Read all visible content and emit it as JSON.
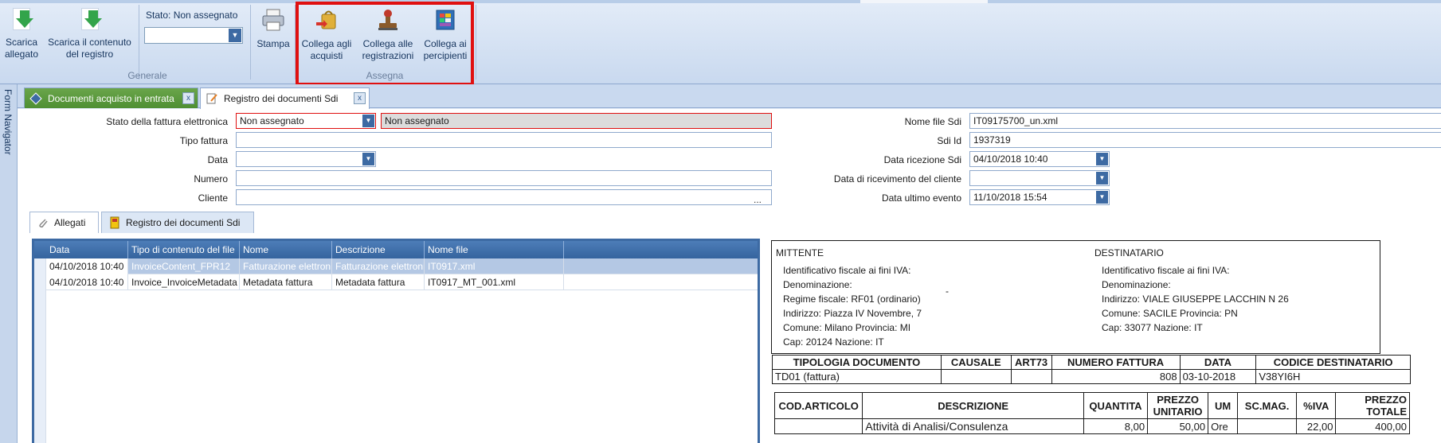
{
  "ribbon": {
    "groups": {
      "generale": "Generale",
      "assegna": "Assegna"
    },
    "buttons": {
      "scarica_allegato": "Scarica\nallegato",
      "scarica_contenuto": "Scarica il contenuto\ndel registro",
      "stampa": "Stampa",
      "collega_acquisti": "Collega agli\nacquisti",
      "collega_registrazioni": "Collega alle\nregistrazioni",
      "collega_percipienti": "Collega ai\npercipienti"
    },
    "stato_label": "Stato: Non assegnato",
    "stato_value": ""
  },
  "form_navigator": "Form Navigator",
  "doc_tabs": [
    {
      "label": "Documenti acquisto in entrata"
    },
    {
      "label": "Registro dei documenti Sdi"
    }
  ],
  "form": {
    "labels": {
      "stato": "Stato della fattura elettronica",
      "tipo": "Tipo fattura",
      "data": "Data",
      "numero": "Numero",
      "cliente": "Cliente",
      "nome_file": "Nome file Sdi",
      "sdi_id": "Sdi Id",
      "data_ricezione": "Data ricezione Sdi",
      "data_ricevimento_cliente": "Data di ricevimento del cliente",
      "data_ultimo_evento": "Data ultimo evento"
    },
    "values": {
      "stato_combo": "Non assegnato",
      "stato_text": "Non assegnato",
      "tipo": "",
      "data": "",
      "numero": "",
      "cliente": "",
      "nome_file": "IT09175700_un.xml",
      "sdi_id": "1937319",
      "data_ricezione": "04/10/2018 10:40",
      "data_ricevimento_cliente": "",
      "data_ultimo_evento": "11/10/2018 15:54"
    },
    "ellipsis": "..."
  },
  "inner_tabs": [
    {
      "label": "Allegati"
    },
    {
      "label": "Registro dei documenti Sdi"
    }
  ],
  "grid": {
    "columns": [
      "Data",
      "Tipo di contenuto del file",
      "Nome",
      "Descrizione",
      "Nome file"
    ],
    "rows": [
      [
        "04/10/2018 10:40",
        "InvoiceContent_FPR12",
        "Fatturazione elettronica",
        "Fatturazione elettronica",
        "IT0917.xml"
      ],
      [
        "04/10/2018 10:40",
        "Invoice_InvoiceMetadata",
        "Metadata fattura",
        "Metadata fattura",
        "IT0917_MT_001.xml"
      ]
    ]
  },
  "preview": {
    "mittente": {
      "title": "MITTENTE",
      "lines": [
        "Identificativo fiscale ai fini IVA:",
        "Denominazione:",
        "Regime fiscale: RF01 (ordinario)",
        "Indirizzo: Piazza IV Novembre, 7",
        "Comune: Milano Provincia: MI",
        "Cap: 20124 Nazione: IT"
      ]
    },
    "dash": "-",
    "destinatario": {
      "title": "DESTINATARIO",
      "lines": [
        "Identificativo fiscale ai fini IVA:",
        "Denominazione:",
        "Indirizzo: VIALE GIUSEPPE LACCHIN N 26",
        "Comune: SACILE Provincia: PN",
        "Cap: 33077 Nazione: IT"
      ]
    },
    "doc_table": {
      "headers": [
        "TIPOLOGIA DOCUMENTO",
        "CAUSALE",
        "ART73",
        "NUMERO FATTURA",
        "DATA",
        "CODICE DESTINATARIO"
      ],
      "row": [
        "TD01 (fattura)",
        "",
        "",
        "808",
        "03-10-2018",
        "V38YI6H"
      ]
    },
    "lines_table": {
      "headers": [
        "COD.ARTICOLO",
        "DESCRIZIONE",
        "QUANTITA",
        "PREZZO\nUNITARIO",
        "UM",
        "SC.MAG.",
        "%IVA",
        "PREZZO\nTOTALE"
      ],
      "row": [
        "",
        "Attività di Analisi/Consulenza",
        "8,00",
        "50,00",
        "Ore",
        "",
        "22,00",
        "400,00"
      ]
    }
  }
}
